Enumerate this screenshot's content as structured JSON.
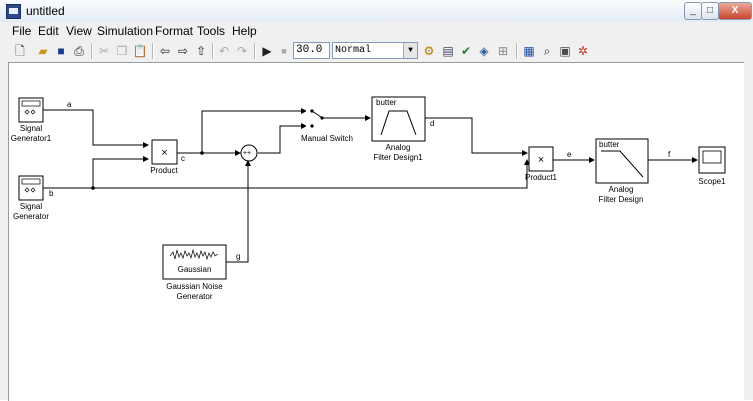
{
  "window": {
    "title": "untitled",
    "minimize": "_",
    "maximize": "□",
    "close": "X"
  },
  "menu": {
    "items": [
      "File",
      "Edit",
      "View",
      "Simulation",
      "Format",
      "Tools",
      "Help"
    ]
  },
  "toolbar": {
    "stop_time": "30.0",
    "solver_mode": "Normal"
  },
  "blocks": {
    "sg1": {
      "name_line1": "Signal",
      "name_line2": "Generator1"
    },
    "sg": {
      "name_line1": "Signal",
      "name_line2": "Generator"
    },
    "product": {
      "name": "Product",
      "symbol": "×"
    },
    "sum": {
      "signs": "++"
    },
    "switch": {
      "name": "Manual Switch"
    },
    "afd1": {
      "icon_text": "butter",
      "name_line1": "Analog",
      "name_line2": "Filter Design1"
    },
    "product1": {
      "name": "Product1",
      "symbol": "×"
    },
    "afd": {
      "icon_text": "butter",
      "name_line1": "Analog",
      "name_line2": "Filter Design"
    },
    "scope": {
      "name": "Scope1"
    },
    "gauss": {
      "icon_text": "Gaussian",
      "name_line1": "Gaussian Noise",
      "name_line2": "Generator"
    }
  },
  "signals": {
    "a": "a",
    "b": "b",
    "c": "c",
    "d": "d",
    "e": "e",
    "f": "f",
    "g": "g"
  }
}
